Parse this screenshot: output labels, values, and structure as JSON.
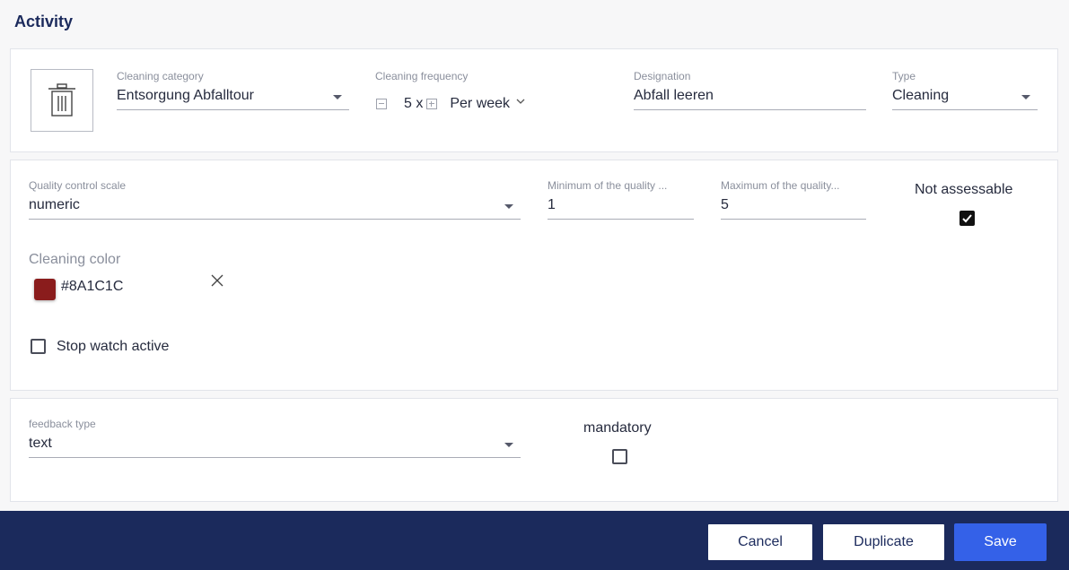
{
  "page": {
    "title": "Activity"
  },
  "activity": {
    "delete_icon": "trash-icon",
    "cleaning_category": {
      "label": "Cleaning category",
      "value": "Entsorgung Abfalltour"
    },
    "cleaning_frequency": {
      "label": "Cleaning frequency",
      "count": "5 x",
      "period": "Per week"
    },
    "designation": {
      "label": "Designation",
      "value": "Abfall leeren"
    },
    "type": {
      "label": "Type",
      "value": "Cleaning"
    }
  },
  "quality": {
    "scale": {
      "label": "Quality control scale",
      "value": "numeric"
    },
    "minimum": {
      "label": "Minimum of the quality ...",
      "value": "1"
    },
    "maximum": {
      "label": "Maximum of the quality...",
      "value": "5"
    },
    "not_assessable": {
      "label": "Not assessable",
      "checked": true
    },
    "cleaning_color": {
      "label": "Cleaning color",
      "value": "#8A1C1C",
      "swatch": "#8A1C1C"
    },
    "stop_watch": {
      "label": "Stop watch active",
      "checked": false
    }
  },
  "feedback": {
    "type": {
      "label": "feedback type",
      "value": "text"
    },
    "mandatory": {
      "label": "mandatory",
      "checked": false
    }
  },
  "footer": {
    "cancel_label": "Cancel",
    "duplicate_label": "Duplicate",
    "save_label": "Save"
  },
  "colors": {
    "navy": "#1B2A5C",
    "primary": "#3461E8",
    "swatch": "#8A1C1C"
  }
}
